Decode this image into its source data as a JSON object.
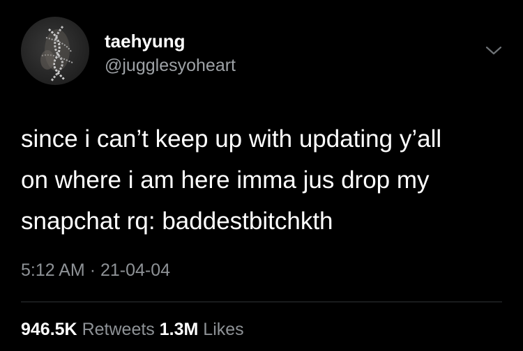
{
  "tweet": {
    "author": {
      "display_name": "taehyung",
      "handle": "@jugglesyoheart",
      "avatar_icon": "avatar-photo"
    },
    "menu_icon": "chevron-down-icon",
    "text_lines": [
      "since i can’t keep up with updating y’all",
      "on where i am here imma jus drop my",
      "snapchat rq: baddestbitchkth"
    ],
    "time": "5:12 AM",
    "separator": "·",
    "date": "21-04-04",
    "stats": {
      "retweets_count": "946.5K",
      "retweets_label": "Retweets",
      "likes_count": "1.3M",
      "likes_label": "Likes"
    },
    "colors": {
      "background": "#000000",
      "primary_text": "#ffffff",
      "secondary_text": "#8e9296",
      "divider": "#2f3336"
    }
  }
}
